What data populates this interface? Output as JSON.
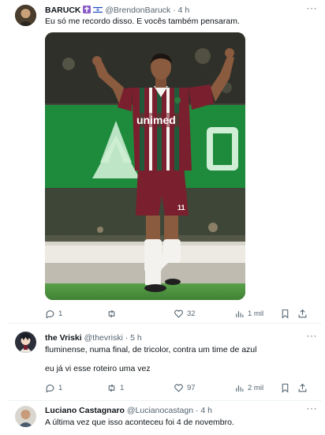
{
  "posts": [
    {
      "name": "BARUCK",
      "handle": "@BrendonBaruck",
      "sep": "·",
      "time": "4 h",
      "text": "Eu só me recordo disso. E vocês também pensaram.",
      "media": {
        "shirt_text": "unimed",
        "number": "11"
      },
      "actions": {
        "replies": "1",
        "reposts": "",
        "likes": "32",
        "views": "1 mil"
      }
    },
    {
      "name": "the Vriski",
      "handle": "@thevriski",
      "sep": "·",
      "time": "5 h",
      "lines": [
        "fluminense, numa final, de tricolor, contra um time de azul",
        "eu já vi esse roteiro uma vez"
      ],
      "actions": {
        "replies": "1",
        "reposts": "1",
        "likes": "97",
        "views": "2 mil"
      }
    },
    {
      "name": "Luciano Castagnaro",
      "handle": "@Lucianocastagn",
      "sep": "·",
      "time": "4 h",
      "text": "A última vez que isso aconteceu foi 4 de novembro."
    }
  ],
  "colors": {
    "text": "#0f1419",
    "muted": "#536471",
    "border": "#eff3f4",
    "shirt_maroon": "#7a1f2e",
    "shirt_green": "#1f5a3a",
    "board_green": "#1e8a3c"
  },
  "icons": [
    "reply-icon",
    "repost-icon",
    "like-icon",
    "views-icon",
    "bookmark-icon",
    "share-icon",
    "more-icon"
  ]
}
